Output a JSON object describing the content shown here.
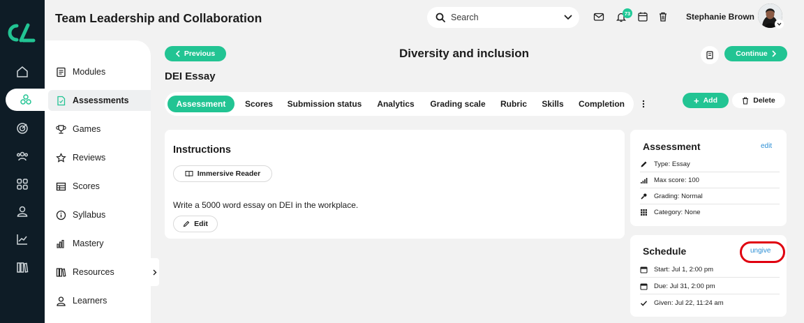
{
  "header": {
    "title": "Team Leadership and Collaboration",
    "search_placeholder": "Search",
    "notification_count": "73",
    "user_name": "Stephanie Brown"
  },
  "rail": {
    "icons": [
      "home-icon",
      "assessments-icon",
      "target-icon",
      "people-icon",
      "apps-icon",
      "user-icon",
      "chart-icon",
      "library-icon"
    ],
    "active_index": 1
  },
  "sidebar": {
    "items": [
      {
        "label": "Modules",
        "icon": "modules-icon"
      },
      {
        "label": "Assessments",
        "icon": "assessment-doc-icon"
      },
      {
        "label": "Games",
        "icon": "trophy-icon"
      },
      {
        "label": "Reviews",
        "icon": "star-icon"
      },
      {
        "label": "Scores",
        "icon": "table-icon"
      },
      {
        "label": "Syllabus",
        "icon": "info-icon"
      },
      {
        "label": "Mastery",
        "icon": "bars-icon"
      },
      {
        "label": "Resources",
        "icon": "books-icon"
      },
      {
        "label": "Learners",
        "icon": "user-icon"
      }
    ],
    "active_index": 1
  },
  "content": {
    "previous_label": "Previous",
    "continue_label": "Continue",
    "page_title": "Diversity and inclusion",
    "section_title": "DEI Essay",
    "tabs": [
      "Assessment",
      "Scores",
      "Submission status",
      "Analytics",
      "Grading scale",
      "Rubric",
      "Skills",
      "Completion"
    ],
    "active_tab": 0,
    "add_label": "Add",
    "delete_label": "Delete"
  },
  "instructions": {
    "title": "Instructions",
    "reader_label": "Immersive Reader",
    "text": "Write a 5000 word essay on DEI in the workplace.",
    "edit_label": "Edit"
  },
  "assessment_card": {
    "title": "Assessment",
    "edit_link": "edit",
    "rows": [
      {
        "icon": "pencil-icon",
        "text": "Type: Essay"
      },
      {
        "icon": "signal-icon",
        "text": "Max score: 100"
      },
      {
        "icon": "grading-icon",
        "text": "Grading: Normal"
      },
      {
        "icon": "grid-icon",
        "text": "Category: None"
      }
    ]
  },
  "schedule_card": {
    "title": "Schedule",
    "ungive_link": "ungive",
    "rows": [
      {
        "icon": "calendar-icon",
        "text": "Start: Jul 1, 2:00 pm"
      },
      {
        "icon": "calendar-icon",
        "text": "Due: Jul 31, 2:00 pm"
      },
      {
        "icon": "check-icon",
        "text": "Given: Jul 22, 11:24 am"
      }
    ]
  },
  "colors": {
    "rail": "#0e1c26",
    "accent": "#22c493",
    "link": "#2d8fd5",
    "highlight": "#e0000f",
    "page_bg": "#f2f2f2"
  }
}
